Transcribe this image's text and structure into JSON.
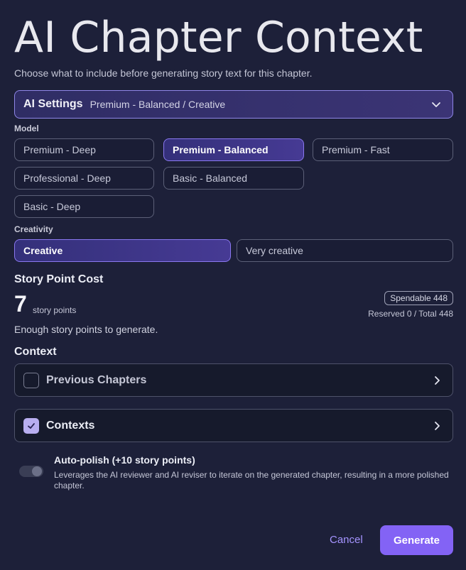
{
  "title": "AI Chapter Context",
  "subtitle": "Choose what to include before generating story text for this chapter.",
  "ai_settings": {
    "label": "AI Settings",
    "value": "Premium - Balanced / Creative"
  },
  "model": {
    "label": "Model",
    "options": [
      "Premium - Deep",
      "Premium - Balanced",
      "Premium - Fast",
      "Professional - Deep",
      "Basic - Balanced",
      "Basic - Deep"
    ],
    "selected": "Premium - Balanced"
  },
  "creativity": {
    "label": "Creativity",
    "options": [
      "Creative",
      "Very creative"
    ],
    "selected": "Creative"
  },
  "cost": {
    "heading": "Story Point Cost",
    "value": "7",
    "unit": "story points",
    "spendable": "Spendable 448",
    "reserved": "Reserved 0 / Total 448",
    "status": "Enough story points to generate."
  },
  "context": {
    "heading": "Context",
    "items": [
      {
        "label": "Previous Chapters",
        "checked": false
      },
      {
        "label": "Contexts",
        "checked": true
      }
    ]
  },
  "auto_polish": {
    "title": "Auto-polish (+10 story points)",
    "description": "Leverages the AI reviewer and AI reviser to iterate on the generated chapter, resulting in a more polished chapter.",
    "enabled": false
  },
  "actions": {
    "cancel": "Cancel",
    "generate": "Generate"
  },
  "colors": {
    "background": "#1d2039",
    "accent": "#8363f5",
    "selected_border": "#8a78f0"
  }
}
